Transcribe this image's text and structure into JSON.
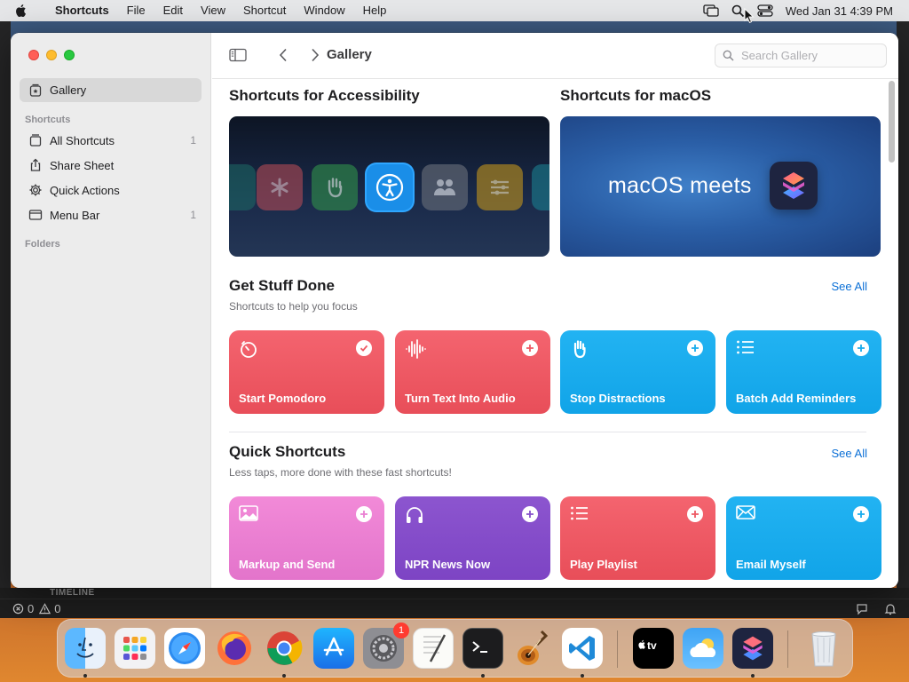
{
  "menubar": {
    "app_name": "Shortcuts",
    "menus": [
      "File",
      "Edit",
      "View",
      "Shortcut",
      "Window",
      "Help"
    ],
    "datetime": "Wed Jan 31  4:39 PM"
  },
  "sidebar": {
    "gallery_label": "Gallery",
    "shortcuts_header": "Shortcuts",
    "items": [
      {
        "label": "All Shortcuts",
        "count": "1"
      },
      {
        "label": "Share Sheet",
        "count": ""
      },
      {
        "label": "Quick Actions",
        "count": ""
      },
      {
        "label": "Menu Bar",
        "count": "1"
      }
    ],
    "folders_header": "Folders"
  },
  "toolbar": {
    "title": "Gallery",
    "search_placeholder": "Search Gallery"
  },
  "featured": [
    {
      "title": "Shortcuts for Accessibility"
    },
    {
      "title": "Shortcuts for macOS",
      "banner_text": "macOS meets"
    }
  ],
  "sections": [
    {
      "title": "Get Stuff Done",
      "subtitle": "Shortcuts to help you focus",
      "see_all": "See All",
      "cards": [
        {
          "name": "Start Pomodoro",
          "color": "red",
          "icon": "timer-icon",
          "action": "check-icon"
        },
        {
          "name": "Turn Text Into Audio",
          "color": "red",
          "icon": "waveform-icon",
          "action": "plus-icon"
        },
        {
          "name": "Stop Distractions",
          "color": "blue",
          "icon": "hand-icon",
          "action": "plus-icon"
        },
        {
          "name": "Batch Add Reminders",
          "color": "blue",
          "icon": "list-icon",
          "action": "plus-icon"
        }
      ]
    },
    {
      "title": "Quick Shortcuts",
      "subtitle": "Less taps, more done with these fast shortcuts!",
      "see_all": "See All",
      "cards": [
        {
          "name": "Markup and Send",
          "color": "pink",
          "icon": "photo-icon",
          "action": "plus-icon"
        },
        {
          "name": "NPR News Now",
          "color": "purple",
          "icon": "headphones-icon",
          "action": "plus-icon"
        },
        {
          "name": "Play Playlist",
          "color": "red",
          "icon": "list-icon",
          "action": "plus-icon"
        },
        {
          "name": "Email Myself",
          "color": "blue",
          "icon": "envelope-icon",
          "action": "plus-icon"
        }
      ]
    }
  ],
  "background_app": {
    "panel_label": "TIMELINE",
    "errors": "0",
    "warnings": "0"
  },
  "dock": {
    "apps": [
      "Finder",
      "Launchpad",
      "Safari",
      "Firefox",
      "Chrome",
      "App Store",
      "System Settings",
      "TextEdit",
      "Terminal",
      "GarageBand",
      "VS Code",
      "Apple TV",
      "Weather",
      "Shortcuts",
      "Trash"
    ],
    "settings_badge": "1"
  },
  "colors": {
    "accent": "#0a6fd6",
    "card_red": "#ee5a64",
    "card_blue": "#19aced",
    "card_pink": "#ea7fd2",
    "card_purple": "#8650ca"
  }
}
